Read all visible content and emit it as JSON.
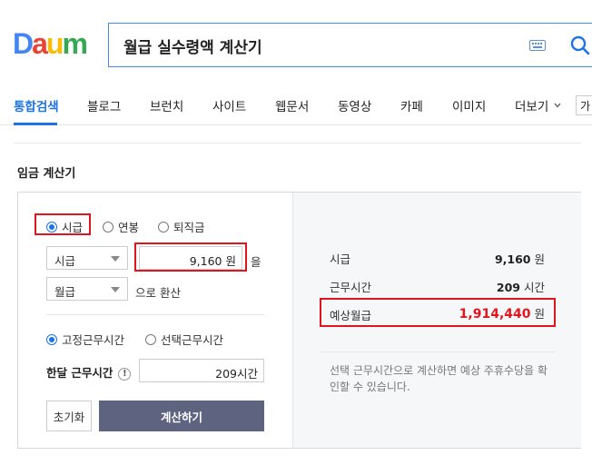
{
  "header": {
    "logo": {
      "letters": [
        "D",
        "a",
        "u",
        "m"
      ],
      "colors": [
        "#4285f4",
        "#ea4335",
        "#fbbc05",
        "#34a853"
      ]
    },
    "search": {
      "query": "월급 실수령액 계산기"
    },
    "icons": {
      "keyboard": "keyboard-icon",
      "search": "search-icon"
    }
  },
  "tabs": [
    {
      "label": "통합검색",
      "active": true
    },
    {
      "label": "블로그"
    },
    {
      "label": "브런치"
    },
    {
      "label": "사이트"
    },
    {
      "label": "웹문서"
    },
    {
      "label": "동영상"
    },
    {
      "label": "카페"
    },
    {
      "label": "이미지"
    },
    {
      "label": "더보기"
    }
  ],
  "tool_box_label": "가",
  "section_title": "임금 계산기",
  "calculator": {
    "pay_type_options": [
      {
        "label": "시급",
        "selected": true
      },
      {
        "label": "연봉",
        "selected": false
      },
      {
        "label": "퇴직금",
        "selected": false
      }
    ],
    "input_unit_select": "시급",
    "amount_value": "9,160",
    "amount_unit": "원",
    "particle_eul": "을",
    "convert_unit_select": "월급",
    "convert_suffix": "으로 환산",
    "work_time_options": [
      {
        "label": "고정근무시간",
        "selected": true
      },
      {
        "label": "선택근무시간",
        "selected": false
      }
    ],
    "monthly_hours_label": "한달 근무시간",
    "monthly_hours_value": "209시간",
    "reset_button": "초기화",
    "calc_button": "계산하기"
  },
  "results": {
    "hourly_label": "시급",
    "hourly_value": "9,160",
    "hourly_unit": "원",
    "hours_label": "근무시간",
    "hours_value": "209",
    "hours_unit": "시간",
    "monthly_label": "예상월급",
    "monthly_value": "1,914,440",
    "monthly_unit": "원",
    "note": "선택 근무시간으로 계산하면 예상 주휴수당을 확인할 수 있습니다."
  },
  "colors": {
    "accent": "#1a73e8",
    "highlight": "#e2141e",
    "calc_button": "#5e6380"
  }
}
